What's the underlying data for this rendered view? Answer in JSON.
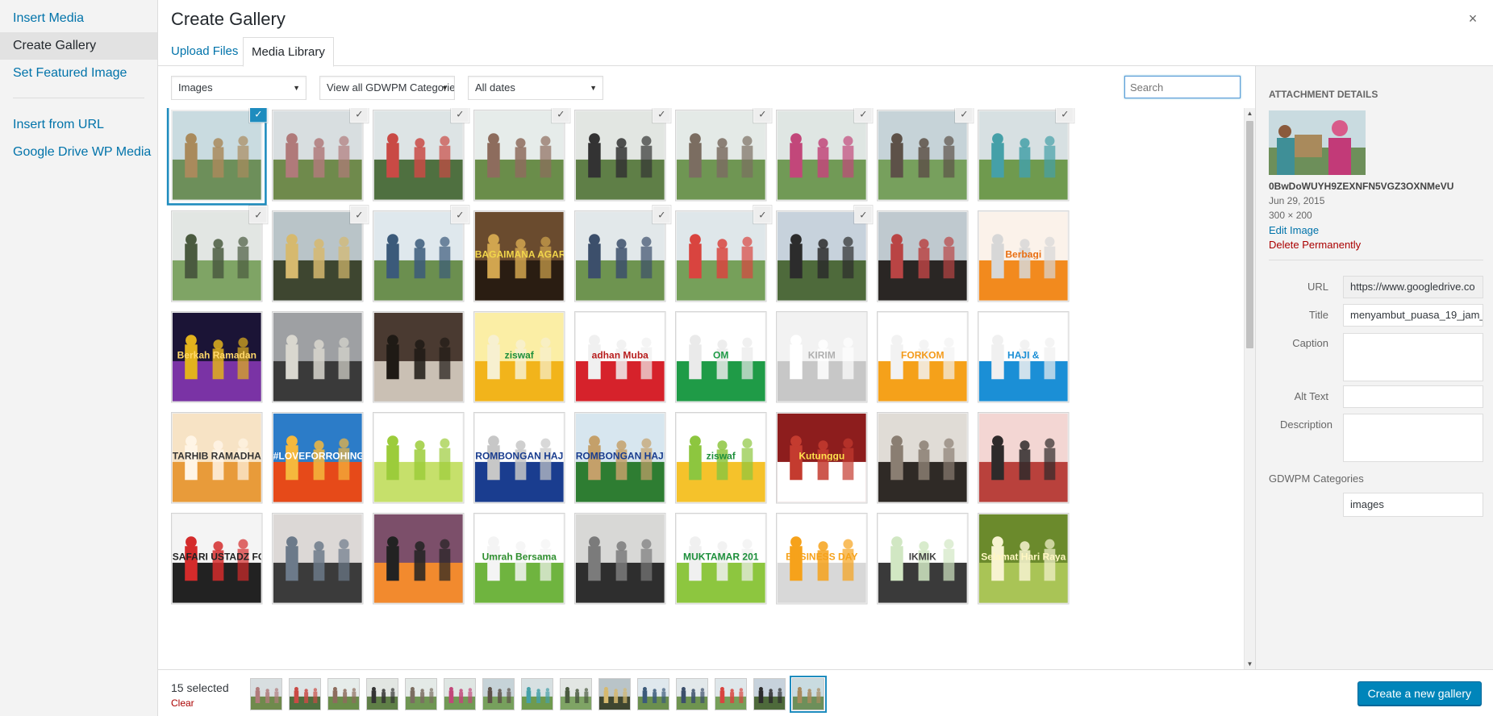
{
  "menu": {
    "items": [
      "Insert Media",
      "Create Gallery",
      "Set Featured Image"
    ],
    "items2": [
      "Insert from URL",
      "Google Drive WP Media"
    ],
    "active_index": 1
  },
  "frame": {
    "title": "Create Gallery",
    "close_symbol": "×"
  },
  "router": {
    "tabs": [
      "Upload Files",
      "Media Library"
    ],
    "active_index": 1
  },
  "filters": {
    "type": "Images",
    "category": "View all GDWPM Categories",
    "date": "All dates",
    "search_placeholder": "Search"
  },
  "attachments": [
    {
      "sel": true,
      "focus": true,
      "c": [
        "#c9dbe0",
        "#6d8f5a",
        "#a98a5c"
      ]
    },
    {
      "sel": true,
      "c": [
        "#d8dee0",
        "#6f8a4c",
        "#b07a7a"
      ]
    },
    {
      "sel": true,
      "c": [
        "#dde4e5",
        "#4f7040",
        "#c94a45"
      ]
    },
    {
      "sel": true,
      "c": [
        "#e6ecea",
        "#6a8d4a",
        "#8d6c5d"
      ]
    },
    {
      "sel": true,
      "c": [
        "#e2e6e2",
        "#5f7f47",
        "#333333"
      ]
    },
    {
      "sel": true,
      "c": [
        "#e4eae7",
        "#6f9653",
        "#7b6d61"
      ]
    },
    {
      "sel": true,
      "c": [
        "#dfe6e3",
        "#719a56",
        "#c2477a"
      ]
    },
    {
      "sel": true,
      "c": [
        "#c6d3d8",
        "#77a05d",
        "#5d5148"
      ]
    },
    {
      "sel": true,
      "c": [
        "#d7e0e2",
        "#6f9a4e",
        "#45a0a8"
      ]
    },
    {
      "sel": true,
      "c": [
        "#e2e6e3",
        "#7fa465",
        "#4a5a3f"
      ]
    },
    {
      "sel": true,
      "c": [
        "#b9c4c8",
        "#3e4630",
        "#d6b96e"
      ]
    },
    {
      "sel": true,
      "c": [
        "#dfe8ed",
        "#6b8f4f",
        "#3b5a7a"
      ]
    },
    {
      "sel": false,
      "c": [
        "#6a4b2e",
        "#2a1d12",
        "#d1a54f"
      ],
      "t": "BAGAIMANA AGAR HIDUP",
      "tc": "#f2d64b"
    },
    {
      "sel": true,
      "c": [
        "#e2e8ea",
        "#6e9450",
        "#3c4f6b"
      ]
    },
    {
      "sel": true,
      "c": [
        "#dfe7ea",
        "#76a05a",
        "#d9443f"
      ]
    },
    {
      "sel": true,
      "c": [
        "#c7d2dc",
        "#4e6a3b",
        "#2c2c2c"
      ]
    },
    {
      "sel": false,
      "c": [
        "#bfc9cf",
        "#2a2624",
        "#b94444"
      ]
    },
    {
      "sel": false,
      "c": [
        "#fbf2ea",
        "#f28a1e",
        "#d7d7d7"
      ],
      "t": "Berbagi",
      "tc": "#e96f12"
    },
    {
      "sel": false,
      "c": [
        "#1b1436",
        "#7a33a5",
        "#e2b21d"
      ],
      "t": "Berkah Ramadan",
      "tc": "#ffd86b"
    },
    {
      "sel": false,
      "c": [
        "#9ea0a3",
        "#3a3a3a",
        "#d9d7cf"
      ]
    },
    {
      "sel": false,
      "c": [
        "#4a3a31",
        "#cac0b4",
        "#1f1a15"
      ]
    },
    {
      "sel": false,
      "c": [
        "#fbeea5",
        "#f2b41b",
        "#f7f0d0"
      ],
      "t": "ziswaf",
      "tc": "#1d8f3b"
    },
    {
      "sel": false,
      "c": [
        "#ffffff",
        "#d6222b",
        "#f0f0f0"
      ],
      "t": "adhan Muba",
      "tc": "#b71c1c"
    },
    {
      "sel": false,
      "c": [
        "#ffffff",
        "#1f9b47",
        "#eaeaea"
      ],
      "t": "OM",
      "tc": "#1f9b47"
    },
    {
      "sel": false,
      "c": [
        "#f2f2f2",
        "#c7c7c7",
        "#ffffff"
      ],
      "t": "KIRIM",
      "tc": "#b0b0b0"
    },
    {
      "sel": false,
      "c": [
        "#ffffff",
        "#f5a11a",
        "#f2f2f2"
      ],
      "t": "FORKOM",
      "tc": "#f39a1a"
    },
    {
      "sel": false,
      "c": [
        "#ffffff",
        "#1b8fd6",
        "#f0f0f0"
      ],
      "t": "HAJI &",
      "tc": "#1b8fd6"
    },
    {
      "sel": false,
      "c": [
        "#f7e3c5",
        "#e89b3a",
        "#fff5e6"
      ],
      "t": "TARHIB RAMADHAN",
      "tc": "#333333"
    },
    {
      "sel": false,
      "c": [
        "#2c7cc8",
        "#e64a19",
        "#f5b83d"
      ],
      "t": "#LOVEFORROHINGYA",
      "tc": "#ffffff"
    },
    {
      "sel": false,
      "c": [
        "#ffffff",
        "#c6e06b",
        "#9ccc3b"
      ]
    },
    {
      "sel": false,
      "c": [
        "#ffffff",
        "#1a3d8f",
        "#c7c7c7"
      ],
      "t": "ROMBONGAN HAJ",
      "tc": "#1a3d8f"
    },
    {
      "sel": false,
      "c": [
        "#d7e6ef",
        "#2e7d32",
        "#c4a06a"
      ],
      "t": "ROMBONGAN HAJI",
      "tc": "#1a3d8f"
    },
    {
      "sel": false,
      "c": [
        "#ffffff",
        "#f5c22b",
        "#8dc63f"
      ],
      "t": "ziswaf",
      "tc": "#1d8f3b"
    },
    {
      "sel": false,
      "c": [
        "#8d1d1d",
        "#ffffff",
        "#c43b2f"
      ],
      "t": "Kutunggu",
      "tc": "#ffe04d"
    },
    {
      "sel": false,
      "c": [
        "#e0dcd6",
        "#2f2a26",
        "#8a7e72"
      ]
    },
    {
      "sel": false,
      "c": [
        "#f3d6d3",
        "#b9413c",
        "#2e2a2a"
      ]
    },
    {
      "sel": false,
      "c": [
        "#f4f4f4",
        "#222222",
        "#d42b2b"
      ],
      "t": "SAFARI USTADZ FORKOM",
      "tc": "#222222"
    },
    {
      "sel": false,
      "c": [
        "#dcd8d6",
        "#3b3b3b",
        "#6c7a8a"
      ]
    },
    {
      "sel": false,
      "c": [
        "#7c4f6a",
        "#f28a2e",
        "#222222"
      ]
    },
    {
      "sel": false,
      "c": [
        "#ffffff",
        "#6fb43f",
        "#f4f4f4"
      ],
      "t": "Umrah Bersama",
      "tc": "#2f8f2f"
    },
    {
      "sel": false,
      "c": [
        "#d8d8d6",
        "#2e2e2e",
        "#7b7b7b"
      ]
    },
    {
      "sel": false,
      "c": [
        "#ffffff",
        "#8dc63f",
        "#f0f0f0"
      ],
      "t": "MUKTAMAR 201",
      "tc": "#1d8f3b"
    },
    {
      "sel": false,
      "c": [
        "#ffffff",
        "#d8d8d8",
        "#f6a21b"
      ],
      "t": "BUSINESS DAY",
      "tc": "#f6a21b"
    },
    {
      "sel": false,
      "c": [
        "#ffffff",
        "#3a3a3a",
        "#d1e7c3"
      ],
      "t": "IKMIK",
      "tc": "#444444"
    },
    {
      "sel": false,
      "c": [
        "#6b8a2c",
        "#a9c456",
        "#f7f3d0"
      ],
      "t": "Selamat Hari Raya",
      "tc": "#fff7c2"
    }
  ],
  "details": {
    "heading": "Attachment Details",
    "filename": "0BwDoWUYH9ZEXNFN5VGZ3OXNMeVU",
    "date": "Jun 29, 2015",
    "dimensions": "300 × 200",
    "edit_label": "Edit Image",
    "delete_label": "Delete Permanently",
    "fields": {
      "url_label": "URL",
      "url_value": "https://www.googledrive.co",
      "title_label": "Title",
      "title_value": "menyambut_puasa_19_jam_",
      "caption_label": "Caption",
      "caption_value": "",
      "alt_label": "Alt Text",
      "alt_value": "",
      "description_label": "Description",
      "description_value": "",
      "categories_label": "GDWPM Categories",
      "categories_value": "images"
    }
  },
  "bottom": {
    "selected_count": "15 selected",
    "clear_label": "Clear",
    "button_label": "Create a new gallery",
    "strip_count": 15
  },
  "colors": {
    "accent": "#0073aa",
    "primary_button": "#0085ba",
    "danger": "#a00",
    "focus": "#1e8cbe"
  }
}
